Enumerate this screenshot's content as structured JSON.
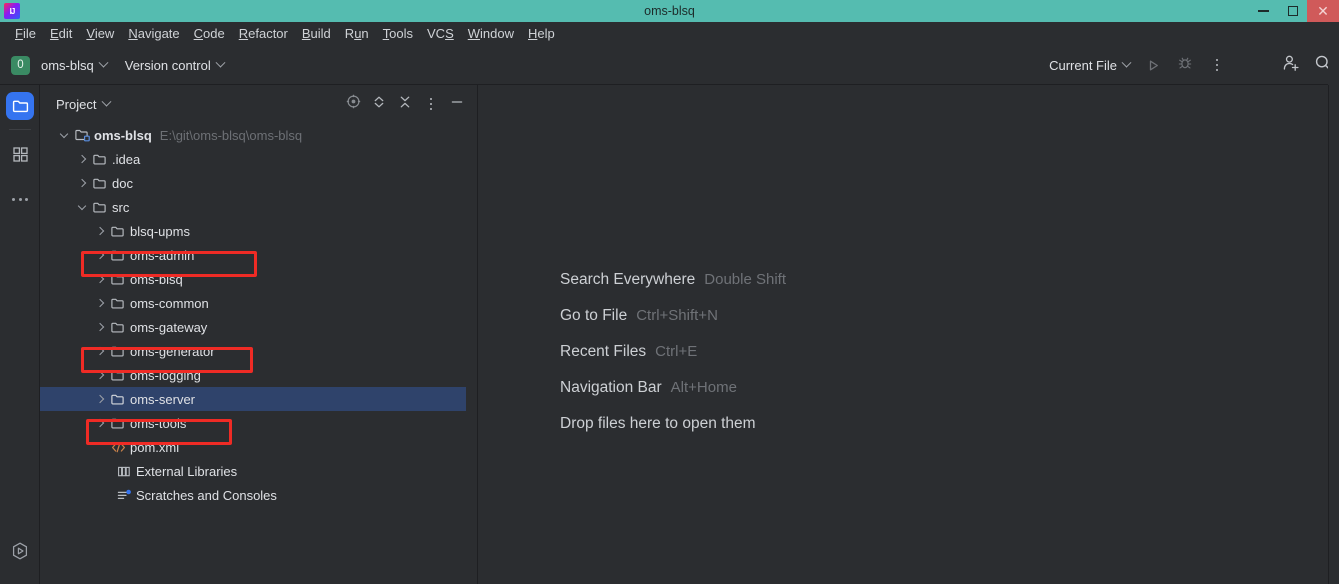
{
  "window": {
    "title": "oms-blsq",
    "logo_text": "IJ",
    "controls": [
      {
        "name": "minimize",
        "glyph": "minimize-icon"
      },
      {
        "name": "restore",
        "glyph": "restore-icon"
      },
      {
        "name": "close",
        "glyph": "close-icon",
        "color": "#d05a5a"
      }
    ],
    "titlebar_color": "#55bcb0"
  },
  "menubar": {
    "items": [
      {
        "label": "File",
        "mnemonic": "F"
      },
      {
        "label": "Edit",
        "mnemonic": "E"
      },
      {
        "label": "View",
        "mnemonic": "V"
      },
      {
        "label": "Navigate",
        "mnemonic": "N"
      },
      {
        "label": "Code",
        "mnemonic": "C"
      },
      {
        "label": "Refactor",
        "mnemonic": "R"
      },
      {
        "label": "Build",
        "mnemonic": "B"
      },
      {
        "label": "Run",
        "mnemonic": "u"
      },
      {
        "label": "Tools",
        "mnemonic": "T"
      },
      {
        "label": "VCS",
        "mnemonic": "S"
      },
      {
        "label": "Window",
        "mnemonic": "W"
      },
      {
        "label": "Help",
        "mnemonic": "H"
      }
    ]
  },
  "toolbar": {
    "project_badge": "0",
    "project_name": "oms-blsq",
    "version_control": "Version control",
    "run_config": "Current File",
    "icons": {
      "run": "run-icon",
      "debug": "debug-icon",
      "more": "more-vertical-icon",
      "add_user": "add-user-icon",
      "search": "search-icon"
    },
    "accent_badge_color": "#3a8a63"
  },
  "activity_bar": {
    "items": [
      {
        "name": "project",
        "icon": "folder-icon",
        "active": true
      },
      {
        "name": "structure",
        "icon": "grid-icon",
        "active": false
      },
      {
        "name": "more",
        "icon": "more-horizontal-icon",
        "active": false
      }
    ],
    "bottom": {
      "name": "services",
      "icon": "services-run-icon"
    },
    "active_color": "#3574f0"
  },
  "project_panel": {
    "title": "Project",
    "header_icons": [
      {
        "name": "select-opened-file",
        "icon": "target-icon"
      },
      {
        "name": "expand-collapse",
        "icon": "up-down-arrows-icon"
      },
      {
        "name": "collapse-all",
        "icon": "collapse-all-icon"
      },
      {
        "name": "options",
        "icon": "more-vertical-icon"
      },
      {
        "name": "hide",
        "icon": "minimize-icon"
      }
    ],
    "tree": [
      {
        "label": "oms-blsq",
        "path": "E:\\git\\oms-blsq\\oms-blsq",
        "depth": 0,
        "twisty": "down",
        "icon": "module-folder-icon",
        "bold": true
      },
      {
        "label": ".idea",
        "depth": 1,
        "twisty": "right",
        "icon": "folder-icon"
      },
      {
        "label": "doc",
        "depth": 1,
        "twisty": "right",
        "icon": "folder-icon"
      },
      {
        "label": "src",
        "depth": 1,
        "twisty": "down",
        "icon": "folder-icon"
      },
      {
        "label": "blsq-upms",
        "depth": 2,
        "twisty": "right",
        "icon": "folder-icon"
      },
      {
        "label": "oms-admin",
        "depth": 2,
        "twisty": "right",
        "icon": "folder-icon",
        "annotated": true
      },
      {
        "label": "oms-blsq",
        "depth": 2,
        "twisty": "right",
        "icon": "folder-icon"
      },
      {
        "label": "oms-common",
        "depth": 2,
        "twisty": "right",
        "icon": "folder-icon"
      },
      {
        "label": "oms-gateway",
        "depth": 2,
        "twisty": "right",
        "icon": "folder-icon",
        "annotated": true
      },
      {
        "label": "oms-generator",
        "depth": 2,
        "twisty": "right",
        "icon": "folder-icon"
      },
      {
        "label": "oms-logging",
        "depth": 2,
        "twisty": "right",
        "icon": "folder-icon"
      },
      {
        "label": "oms-server",
        "depth": 2,
        "twisty": "right",
        "icon": "folder-icon",
        "annotated": true,
        "selected": true
      },
      {
        "label": "oms-tools",
        "depth": 2,
        "twisty": "right",
        "icon": "folder-icon"
      },
      {
        "label": "pom.xml",
        "depth": 2,
        "twisty": "none",
        "icon": "xml-file-icon"
      },
      {
        "label": "External Libraries",
        "depth": 0,
        "twisty": "none",
        "icon": "libraries-icon"
      },
      {
        "label": "Scratches and Consoles",
        "depth": 0,
        "twisty": "none",
        "icon": "scratches-icon"
      }
    ],
    "selection_color": "#2f436b",
    "annotation_color": "#ef2b25"
  },
  "editor": {
    "placeholder_rows": [
      {
        "action": "Search Everywhere",
        "shortcut": "Double Shift"
      },
      {
        "action": "Go to File",
        "shortcut": "Ctrl+Shift+N"
      },
      {
        "action": "Recent Files",
        "shortcut": "Ctrl+E"
      },
      {
        "action": "Navigation Bar",
        "shortcut": "Alt+Home"
      },
      {
        "action": "Drop files here to open them",
        "shortcut": ""
      }
    ]
  }
}
